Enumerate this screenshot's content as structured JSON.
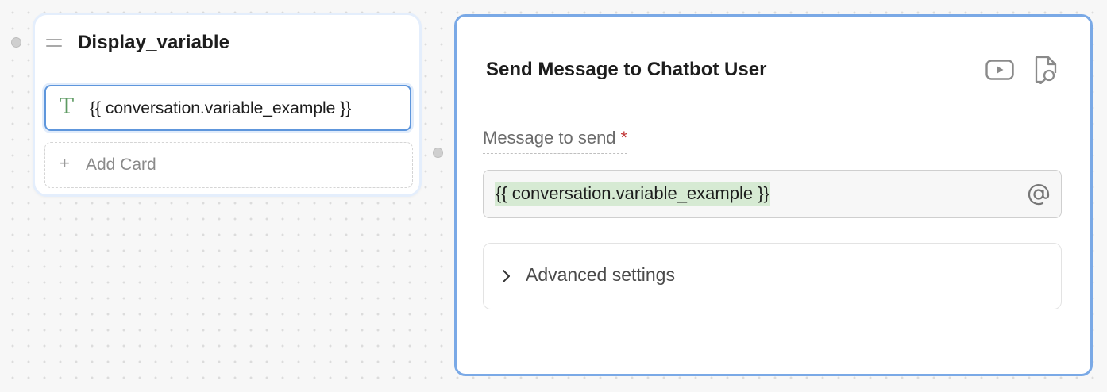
{
  "node": {
    "title": "Display_variable",
    "text_card": {
      "icon": "text-type-icon",
      "icon_glyph": "T",
      "content": "{{ conversation.variable_example }}"
    },
    "add_card_icon": "+",
    "add_card_label": "Add Card"
  },
  "panel": {
    "title": "Send Message to Chatbot User",
    "icons": [
      "video-play-icon",
      "document-search-icon"
    ],
    "message_field": {
      "label": "Message to send",
      "required_mark": "*",
      "value": "{{ conversation.variable_example }}",
      "mention_icon": "at-sign-icon"
    },
    "advanced_settings_label": "Advanced settings"
  },
  "colors": {
    "accent_border": "#7aa9e6",
    "variable_chip": "#d6ead3",
    "required": "#c23a3a",
    "text_icon": "#5d9a62"
  }
}
